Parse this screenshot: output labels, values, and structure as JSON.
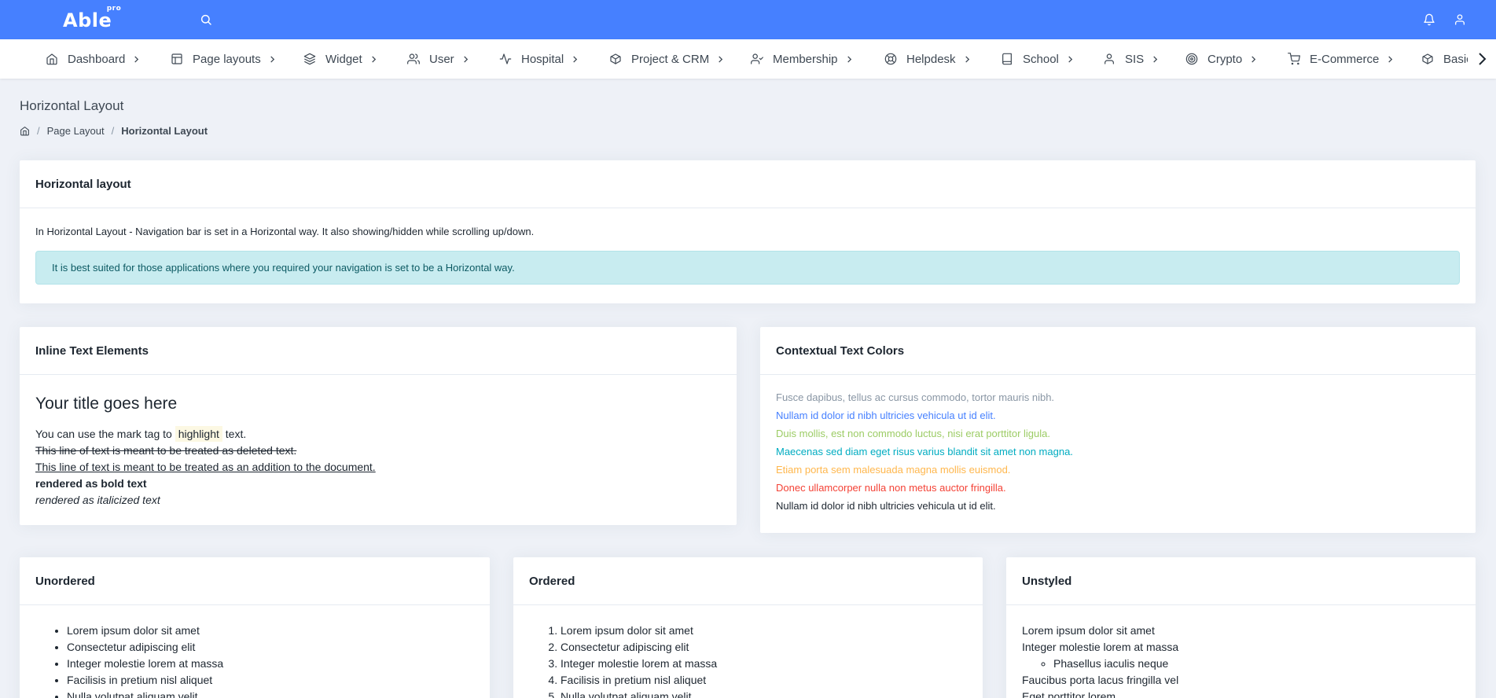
{
  "app": {
    "logo": "Able",
    "logo_badge": "pro"
  },
  "colors": {
    "topbar": "#4680ff",
    "muted": "#8996a4",
    "primary": "#4680ff",
    "success": "#9ccc65",
    "info": "#00bcd4",
    "warning": "#ffb74d",
    "danger": "#f44236",
    "dark": "#1d2630"
  },
  "nav": {
    "items": [
      {
        "label": "Dashboard",
        "icon": "home-icon"
      },
      {
        "label": "Page layouts",
        "icon": "layout-icon"
      },
      {
        "label": "Widget",
        "icon": "layers-icon"
      },
      {
        "label": "User",
        "icon": "users-icon"
      },
      {
        "label": "Hospital",
        "icon": "activity-icon"
      },
      {
        "label": "Project & CRM",
        "icon": "box-icon"
      },
      {
        "label": "Membership",
        "icon": "user-check-icon"
      },
      {
        "label": "Helpdesk",
        "icon": "life-buoy-icon"
      },
      {
        "label": "School",
        "icon": "book-icon"
      },
      {
        "label": "SIS",
        "icon": "user-icon"
      },
      {
        "label": "Crypto",
        "icon": "target-icon"
      },
      {
        "label": "E-Commerce",
        "icon": "cart-icon"
      },
      {
        "label": "Basic",
        "icon": "package-icon"
      }
    ]
  },
  "page": {
    "title": "Horizontal Layout",
    "breadcrumb": {
      "home_icon": "home-icon",
      "parent": "Page Layout",
      "current": "Horizontal Layout",
      "separator": "/"
    }
  },
  "horizontal_card": {
    "title": "Horizontal layout",
    "text": "In Horizontal Layout - Navigation bar is set in a Horizontal way. It also showing/hidden while scrolling up/down.",
    "alert": "It is best suited for those applications where you required your navigation is set to be a Horizontal way."
  },
  "inline_card": {
    "title": "Inline Text Elements",
    "heading": "Your title goes here",
    "mark_before": "You can use the mark tag to ",
    "mark_word": "highlight",
    "mark_after": " text.",
    "deleted": "This line of text is meant to be treated as deleted text.",
    "underlined": "This line of text is meant to be treated as an addition to the document.",
    "bold": "rendered as bold text",
    "italic": "rendered as italicized text"
  },
  "contextual_card": {
    "title": "Contextual Text Colors",
    "lines": [
      {
        "text": "Fusce dapibus, tellus ac cursus commodo, tortor mauris nibh.",
        "color": "#8996a4"
      },
      {
        "text": "Nullam id dolor id nibh ultricies vehicula ut id elit.",
        "color": "#4680ff"
      },
      {
        "text": "Duis mollis, est non commodo luctus, nisi erat porttitor ligula.",
        "color": "#9ccc65"
      },
      {
        "text": "Maecenas sed diam eget risus varius blandit sit amet non magna.",
        "color": "#00acc1"
      },
      {
        "text": "Etiam porta sem malesuada magna mollis euismod.",
        "color": "#ffb74d"
      },
      {
        "text": "Donec ullamcorper nulla non metus auctor fringilla.",
        "color": "#f44236"
      },
      {
        "text": "Nullam id dolor id nibh ultricies vehicula ut id elit.",
        "color": "#1d2630"
      }
    ]
  },
  "unordered_card": {
    "title": "Unordered",
    "items": [
      "Lorem ipsum dolor sit amet",
      "Consectetur adipiscing elit",
      "Integer molestie lorem at massa",
      "Facilisis in pretium nisl aliquet",
      "Nulla volutpat aliquam velit"
    ]
  },
  "ordered_card": {
    "title": "Ordered",
    "items": [
      "Lorem ipsum dolor sit amet",
      "Consectetur adipiscing elit",
      "Integer molestie lorem at massa",
      "Facilisis in pretium nisl aliquet",
      "Nulla volutpat aliquam velit"
    ]
  },
  "unstyled_card": {
    "title": "Unstyled",
    "item1": "Lorem ipsum dolor sit amet",
    "item2": "Integer molestie lorem at massa",
    "nested": "Phasellus iaculis neque",
    "item3": "Faucibus porta lacus fringilla vel",
    "item4": "Eget porttitor lorem"
  }
}
